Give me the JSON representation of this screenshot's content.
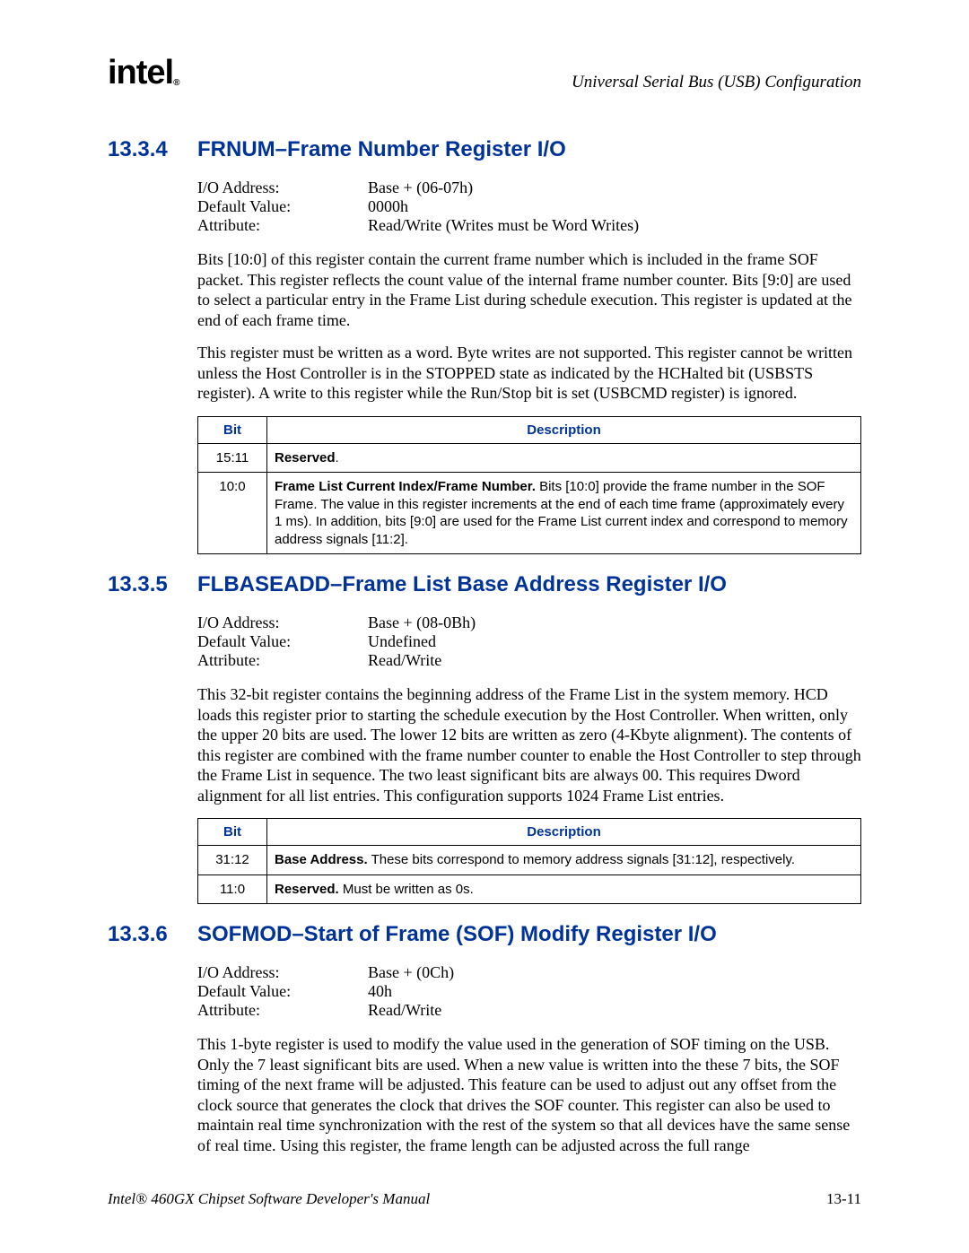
{
  "header": {
    "logo_text": "intel",
    "logo_r": "®",
    "doc_section": "Universal Serial Bus (USB) Configuration"
  },
  "s1": {
    "num": "13.3.4",
    "title": "FRNUM–Frame Number Register I/O",
    "attrs": {
      "io_label": "I/O Address:",
      "io_val": "Base + (06-07h)",
      "def_label": "Default Value:",
      "def_val": "0000h",
      "attr_label": "Attribute:",
      "attr_val": "Read/Write (Writes must be Word Writes)"
    },
    "p1": "Bits [10:0] of this register contain the current frame number which is included in the frame SOF packet. This register reflects the count value of the internal frame number counter. Bits [9:0] are used to select a particular entry in the Frame List during schedule execution. This register is updated at the end of each frame time.",
    "p2": "This register must be written as a word. Byte writes are not supported. This register cannot be written unless the Host Controller is in the STOPPED state as indicated by the HCHalted bit (USBSTS register). A write to this register while the Run/Stop bit is set (USBCMD register) is ignored.",
    "th_bit": "Bit",
    "th_desc": "Description",
    "r1_bit": "15:11",
    "r1_desc_b": "Reserved",
    "r1_desc_tail": ".",
    "r2_bit": "10:0",
    "r2_desc_b": "Frame List Current Index/Frame Number.",
    "r2_desc_tail": " Bits [10:0] provide the frame number in the SOF Frame. The value in this register increments at the end of each time frame (approximately every 1 ms). In addition, bits [9:0] are used for the Frame List current index and correspond to memory address signals [11:2]."
  },
  "s2": {
    "num": "13.3.5",
    "title": "FLBASEADD–Frame List Base Address Register I/O",
    "attrs": {
      "io_label": "I/O Address:",
      "io_val": "Base + (08-0Bh)",
      "def_label": "Default Value:",
      "def_val": "Undefined",
      "attr_label": "Attribute:",
      "attr_val": "Read/Write"
    },
    "p1": "This 32-bit register contains the beginning address of the Frame List in the system memory. HCD loads this register prior to starting the schedule execution by the Host Controller. When written, only the upper 20 bits are used. The lower 12 bits are written as zero (4-Kbyte alignment). The contents of this register are combined with the frame number counter to enable the Host Controller to step through the Frame List in sequence. The two least significant bits are always 00. This requires Dword alignment for all list entries. This configuration supports 1024 Frame List entries.",
    "th_bit": "Bit",
    "th_desc": "Description",
    "r1_bit": "31:12",
    "r1_desc_b": "Base Address.",
    "r1_desc_tail": " These bits correspond to memory address signals [31:12], respectively.",
    "r2_bit": "11:0",
    "r2_desc_b": "Reserved.",
    "r2_desc_tail": " Must be written as 0s."
  },
  "s3": {
    "num": "13.3.6",
    "title": "SOFMOD–Start of Frame (SOF) Modify Register I/O",
    "attrs": {
      "io_label": "I/O Address:",
      "io_val": "Base + (0Ch)",
      "def_label": "Default Value:",
      "def_val": "40h",
      "attr_label": "Attribute:",
      "attr_val": "Read/Write"
    },
    "p1": "This 1-byte register is used to modify the value used in the generation of SOF timing on the USB. Only the 7 least significant bits are used. When a new value is written into the these 7 bits, the SOF timing of the next frame will be adjusted. This feature can be used to adjust out any offset from the clock source that generates the clock that drives the SOF counter. This register can also be used to maintain real time synchronization with the rest of the system so that all devices have the same sense of real time. Using this register, the frame length can be adjusted across the full range"
  },
  "footer": {
    "left": "Intel® 460GX Chipset Software Developer's Manual",
    "right": "13-11"
  }
}
